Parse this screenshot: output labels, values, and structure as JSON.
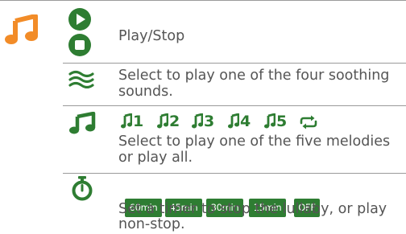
{
  "rows": [
    {
      "icons": [
        "play-icon",
        "stop-icon"
      ],
      "description": "Play/Stop"
    },
    {
      "icons": [
        "waves-icon"
      ],
      "description_lines": [
        "Select to play one of the four soothing",
        "sounds."
      ]
    },
    {
      "icons": [
        "music-note-icon"
      ],
      "melody_buttons": [
        "1",
        "2",
        "3",
        "4",
        "5"
      ],
      "repeat_icon": "repeat-icon",
      "description_lines": [
        "Select to play one of the five melodies",
        "or play all."
      ]
    },
    {
      "icons": [
        "timer-icon"
      ],
      "timer_buttons": [
        "60min",
        "45min",
        "30min",
        "15min",
        "OFF"
      ],
      "description_lines": [
        "Set a timer to stop the lullaby, or play",
        "non-stop."
      ]
    }
  ],
  "header_icon": "music-note-icon",
  "colors": {
    "accent_orange": "#f28c28",
    "accent_green": "#2e7d32",
    "text": "#555555"
  }
}
